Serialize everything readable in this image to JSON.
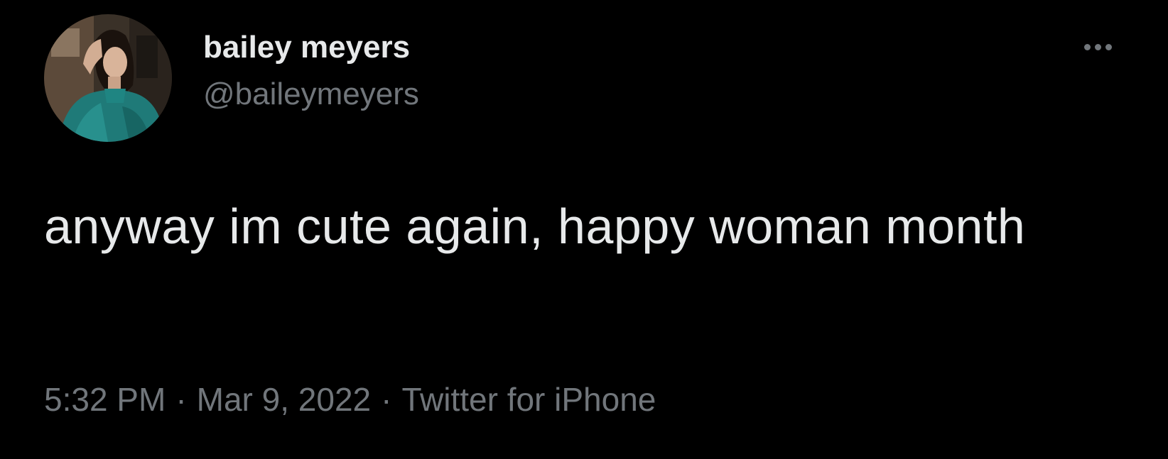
{
  "tweet": {
    "author": {
      "display_name": "bailey meyers",
      "handle": "@baileymeyers"
    },
    "text": "anyway im cute again, happy woman month",
    "time": "5:32 PM",
    "date": "Mar 9, 2022",
    "separator": "·",
    "source": "Twitter for iPhone",
    "more_icon": "more-horizontal-icon"
  },
  "theme": {
    "background": "#000000",
    "primary_text": "#e7e9ea",
    "secondary_text": "#71767b"
  }
}
